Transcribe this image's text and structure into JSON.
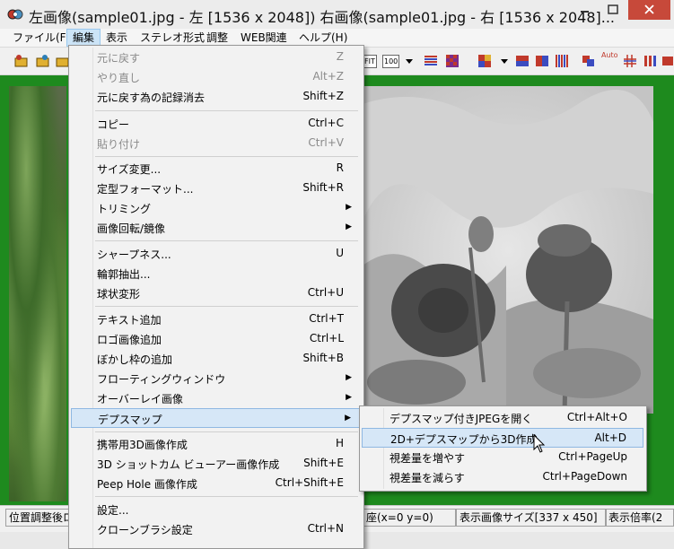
{
  "window": {
    "title": "左画像(sample01.jpg - 左 [1536 x 2048]) 右画像(sample01.jpg - 右 [1536 x 2048]..."
  },
  "menubar": [
    {
      "label": "ファイル(F)"
    },
    {
      "label": "編集"
    },
    {
      "label": "表示"
    },
    {
      "label": "ステレオ形式"
    },
    {
      "label": "調整"
    },
    {
      "label": "WEB関連"
    },
    {
      "label": "ヘルプ(H)"
    }
  ],
  "toolbar": {
    "fit_label": "FIT",
    "zoom_label": "100",
    "auto_label": "Auto"
  },
  "edit_menu": {
    "items": [
      {
        "label": "元に戻す",
        "shortcut": "Z"
      },
      {
        "label": "やり直し",
        "shortcut": "Alt+Z"
      },
      {
        "label": "元に戻す為の記録消去",
        "shortcut": "Shift+Z"
      },
      {
        "label": "コピー",
        "shortcut": "Ctrl+C"
      },
      {
        "label": "貼り付け",
        "shortcut": "Ctrl+V"
      },
      {
        "label": "サイズ変更...",
        "shortcut": "R"
      },
      {
        "label": "定型フォーマット...",
        "shortcut": "Shift+R"
      },
      {
        "label": "トリミング",
        "shortcut": ""
      },
      {
        "label": "画像回転/鏡像",
        "shortcut": ""
      },
      {
        "label": "シャープネス...",
        "shortcut": "U"
      },
      {
        "label": "輪郭抽出...",
        "shortcut": ""
      },
      {
        "label": "球状変形",
        "shortcut": "Ctrl+U"
      },
      {
        "label": "テキスト追加",
        "shortcut": "Ctrl+T"
      },
      {
        "label": "ロゴ画像追加",
        "shortcut": "Ctrl+L"
      },
      {
        "label": "ぼかし枠の追加",
        "shortcut": "Shift+B"
      },
      {
        "label": "フローティングウィンドウ",
        "shortcut": ""
      },
      {
        "label": "オーバーレイ画像",
        "shortcut": ""
      },
      {
        "label": "デプスマップ",
        "shortcut": ""
      },
      {
        "label": "携帯用3D画像作成",
        "shortcut": "H"
      },
      {
        "label": "3D ショットカム ビューアー画像作成",
        "shortcut": "Shift+E"
      },
      {
        "label": "Peep Hole 画像作成",
        "shortcut": "Ctrl+Shift+E"
      },
      {
        "label": "設定...",
        "shortcut": ""
      },
      {
        "label": "クローンブラシ設定",
        "shortcut": "Ctrl+N"
      }
    ]
  },
  "depthmap_submenu": {
    "items": [
      {
        "label": "デプスマップ付きJPEGを開く",
        "shortcut": "Ctrl+Alt+O"
      },
      {
        "label": "2D+デプスマップから3D作成",
        "shortcut": "Alt+D"
      },
      {
        "label": "視差量を増やす",
        "shortcut": "Ctrl+PageUp"
      },
      {
        "label": "視差量を減らす",
        "shortcut": "Ctrl+PageDown"
      }
    ]
  },
  "statusbar": {
    "left": "位置調整後ロ",
    "coords": "座(x=0 y=0)",
    "display_size": "表示画像サイズ[337 x 450]",
    "zoom": "表示倍率(2"
  }
}
